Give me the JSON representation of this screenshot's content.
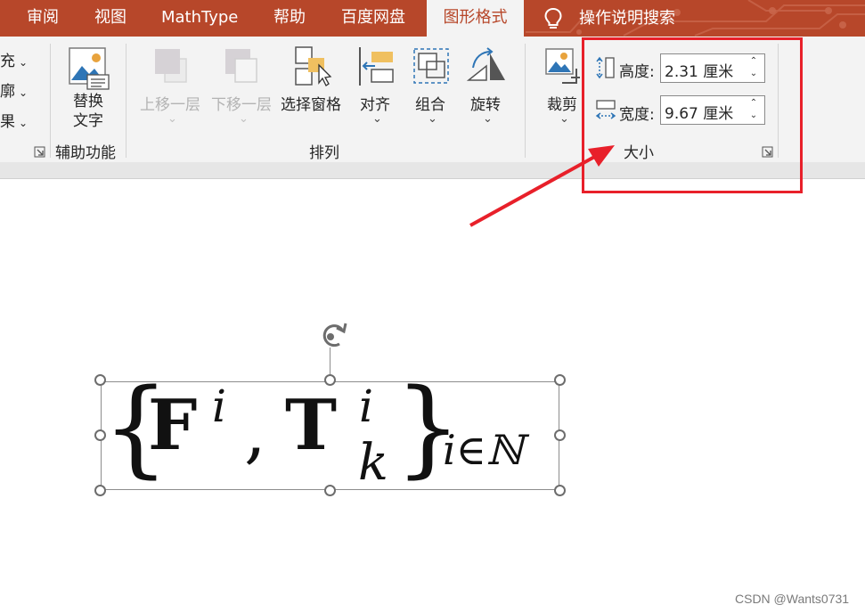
{
  "tabs": [
    {
      "label": "审阅",
      "active": false
    },
    {
      "label": "视图",
      "active": false
    },
    {
      "label": "MathType",
      "active": false
    },
    {
      "label": "帮助",
      "active": false
    },
    {
      "label": "百度网盘",
      "active": false
    },
    {
      "label": "图形格式",
      "active": true
    }
  ],
  "search": {
    "label": "操作说明搜索",
    "icon": "lightbulb-icon"
  },
  "ribbon": {
    "partial_items": [
      "充",
      "廓",
      "果"
    ],
    "accessibility": {
      "alt_text_label_line1": "替换",
      "alt_text_label_line2": "文字",
      "group_title": "辅助功能"
    },
    "arrange": {
      "bring_forward": "上移一层",
      "send_backward": "下移一层",
      "selection_pane": "选择窗格",
      "align": "对齐",
      "group": "组合",
      "rotate": "旋转",
      "group_title": "排列"
    },
    "crop": {
      "label": "裁剪"
    },
    "size": {
      "height_label": "高度:",
      "height_value": "2.31 厘米",
      "width_label": "宽度:",
      "width_value": "9.67 厘米",
      "group_title": "大小"
    }
  },
  "formula": {
    "open_brace": "{",
    "F": "F",
    "sup_i1": "i",
    "comma": ",",
    "T": "T",
    "sup_i2": "i",
    "sub_k": "k",
    "close_brace": "}",
    "sub_index": "i∈ℕ"
  },
  "colors": {
    "tab_bar": "#b7472a",
    "annotation": "#e8202a"
  },
  "watermark": "CSDN @Wants0731"
}
